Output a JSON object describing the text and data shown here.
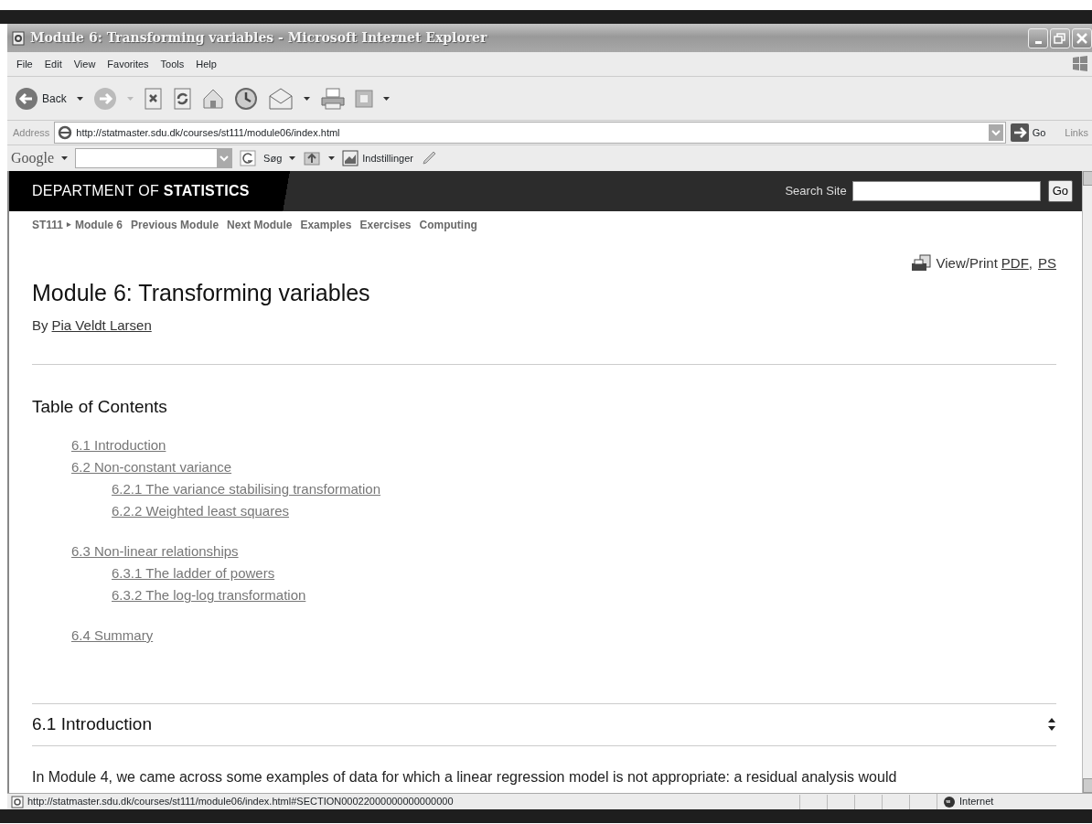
{
  "window": {
    "title": "Module 6: Transforming variables - Microsoft Internet Explorer"
  },
  "menu": [
    "File",
    "Edit",
    "View",
    "Favorites",
    "Tools",
    "Help"
  ],
  "toolbar": {
    "back_label": "Back"
  },
  "address_bar": {
    "label": "Address",
    "url": "http://statmaster.sdu.dk/courses/st111/module06/index.html",
    "go": "Go",
    "links": "Links"
  },
  "google_bar": {
    "logo": "Google",
    "search": "Søg",
    "settings": "Indstillinger"
  },
  "page": {
    "header": {
      "brand": "DEPARTMENT OF **STATISTICS**",
      "search_label": "Search Site",
      "search_button": "Go"
    },
    "breadcrumb": [
      {
        "kind": "crumb",
        "text": "ST111"
      },
      {
        "kind": "separator",
        "text": "▸"
      },
      {
        "kind": "crumb",
        "text": "Module 6"
      },
      {
        "kind": "link",
        "text": "Previous Module"
      },
      {
        "kind": "link",
        "text": "Next Module"
      },
      {
        "kind": "link",
        "text": "Examples"
      },
      {
        "kind": "link",
        "text": "Exercises"
      },
      {
        "kind": "link",
        "text": "Computing"
      }
    ],
    "view_print": {
      "label": "View/Print",
      "links": [
        "PDF",
        "PS"
      ],
      "separator": ","
    },
    "title": "Module 6: Transforming variables",
    "author_prefix": "By",
    "author": "Pia Veldt Larsen",
    "toc": {
      "heading": "Table of Contents",
      "items": [
        {
          "text": "6.1 Introduction"
        },
        {
          "text": "6.2 Non-constant variance",
          "children": [
            {
              "text": "6.2.1 The variance stabilising transformation"
            },
            {
              "text": "6.2.2 Weighted least squares"
            }
          ]
        },
        {
          "text": "6.3 Non-linear relationships",
          "children": [
            {
              "text": "6.3.1 The ladder of powers"
            },
            {
              "text": "6.3.2 The log-log transformation"
            }
          ]
        },
        {
          "text": "6.4 Summary"
        }
      ]
    },
    "section": {
      "heading": "6.1 Introduction",
      "paragraph": "In Module 4, we came across some examples of data for which a linear regression model is not appropriate: a residual analysis would"
    }
  },
  "status_bar": {
    "url": "http://statmaster.sdu.dk/courses/st111/module06/index.html#SECTION00022000000000000000",
    "zone": "Internet"
  }
}
